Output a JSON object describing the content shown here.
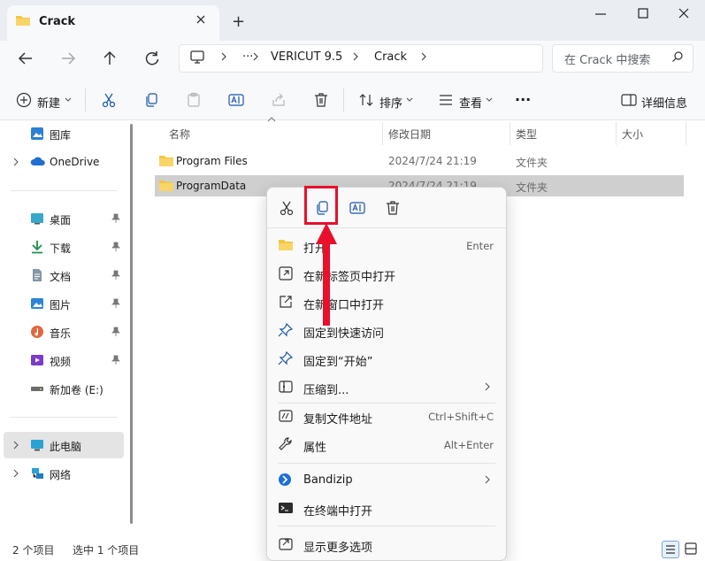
{
  "window": {
    "tab_title": "Crack",
    "new_tab_symbol": "+",
    "minimize_symbol": "—",
    "maximize_symbol": "☐",
    "close_symbol": "✕"
  },
  "address": {
    "more": "···",
    "crumbs": [
      "VERICUT 9.5",
      "Crack"
    ],
    "search_placeholder": "在 Crack 中搜索"
  },
  "toolbar": {
    "new_label": "新建",
    "sort_label": "排序",
    "view_label": "查看",
    "more_label": "···",
    "details_label": "详细信息"
  },
  "sidebar": {
    "items": [
      {
        "label": "图库",
        "icon": "gallery-icon"
      },
      {
        "label": "OneDrive",
        "icon": "cloud-icon"
      },
      {
        "label": "桌面",
        "icon": "desktop-icon"
      },
      {
        "label": "下载",
        "icon": "download-icon"
      },
      {
        "label": "文档",
        "icon": "document-icon"
      },
      {
        "label": "图片",
        "icon": "picture-icon"
      },
      {
        "label": "音乐",
        "icon": "music-icon"
      },
      {
        "label": "视频",
        "icon": "video-icon"
      },
      {
        "label": "新加卷 (E:)",
        "icon": "drive-icon"
      },
      {
        "label": "此电脑",
        "icon": "computer-icon"
      },
      {
        "label": "网络",
        "icon": "network-icon"
      }
    ]
  },
  "columns": {
    "name": "名称",
    "date": "修改日期",
    "type": "类型",
    "size": "大小"
  },
  "files": [
    {
      "name": "Program Files",
      "date": "2024/7/24 21:19",
      "type": "文件夹"
    },
    {
      "name": "ProgramData",
      "date": "2024/7/24 21:19",
      "type": "文件夹"
    }
  ],
  "status": {
    "count": "2 个项目",
    "selected": "选中 1 个项目"
  },
  "context_menu": {
    "items": [
      {
        "label": "打开",
        "shortcut": "Enter",
        "icon": "folder-open-icon"
      },
      {
        "label": "在新标签页中打开",
        "shortcut": "",
        "icon": "new-tab-icon"
      },
      {
        "label": "在新窗口中打开",
        "shortcut": "",
        "icon": "new-window-icon"
      },
      {
        "label": "固定到快速访问",
        "shortcut": "",
        "icon": "pin-icon"
      },
      {
        "label": "固定到“开始”",
        "shortcut": "",
        "icon": "pin-start-icon"
      },
      {
        "label": "压缩到...",
        "shortcut": "",
        "icon": "zip-icon"
      },
      {
        "label": "复制文件地址",
        "shortcut": "Ctrl+Shift+C",
        "icon": "copy-path-icon"
      },
      {
        "label": "属性",
        "shortcut": "Alt+Enter",
        "icon": "wrench-icon"
      },
      {
        "label": "Bandizip",
        "shortcut": "",
        "icon": "bandizip-icon"
      },
      {
        "label": "在终端中打开",
        "shortcut": "",
        "icon": "terminal-icon"
      },
      {
        "label": "显示更多选项",
        "shortcut": "",
        "icon": "more-options-icon"
      }
    ]
  },
  "colors": {
    "highlight": "#e8102a",
    "selection": "#cfcfcf",
    "folder": "#f4c542",
    "accent": "#0067c0"
  }
}
